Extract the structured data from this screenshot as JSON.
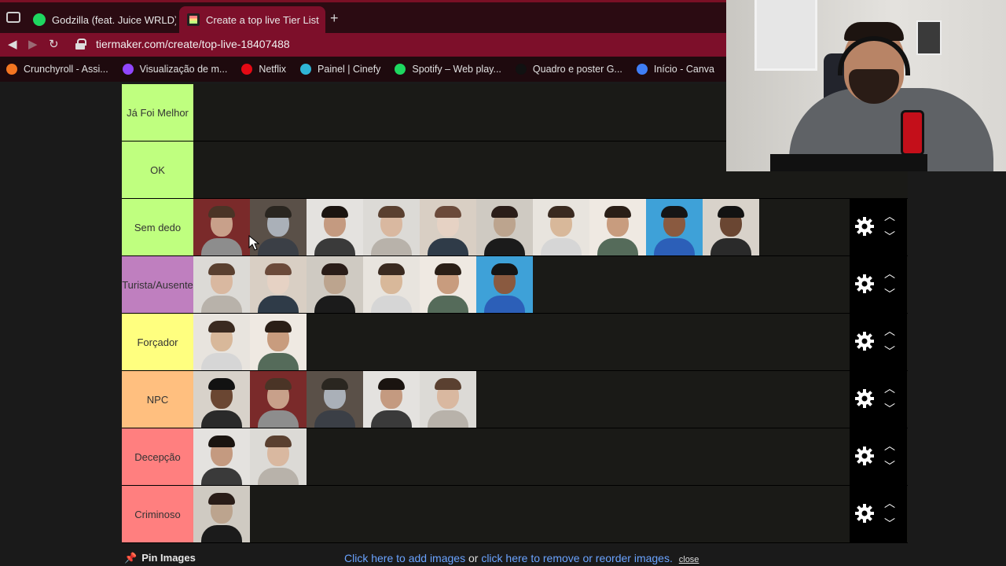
{
  "browser": {
    "tabs": [
      {
        "label": "Godzilla (feat. Juice WRLD)",
        "icon": "spotify-icon",
        "active": false
      },
      {
        "label": "Create a top live Tier List",
        "icon": "tiermaker-icon",
        "active": true
      }
    ],
    "new_tab": "+",
    "url": "tiermaker.com/create/top-live-18407488",
    "bookmarks": [
      {
        "label": "Crunchyroll - Assi...",
        "color": "#f47521"
      },
      {
        "label": "Visualização de m...",
        "color": "#9146ff"
      },
      {
        "label": "Netflix",
        "color": "#e50914"
      },
      {
        "label": "Painel | Cinefy",
        "color": "#2fb5d6"
      },
      {
        "label": "Spotify – Web play...",
        "color": "#1ed760"
      },
      {
        "label": "Quadro e poster G...",
        "color": "#111111"
      },
      {
        "label": "Início - Canva",
        "color": "#3f7ef6"
      }
    ]
  },
  "tiers": [
    {
      "label": "Já Foi Melhor",
      "color": "#bfff7f",
      "count": 0
    },
    {
      "label": "OK",
      "color": "#bfff7f",
      "count": 0
    },
    {
      "label": "Sem dedo",
      "color": "#bfff7f",
      "count": 10
    },
    {
      "label": "Turista/Ausente",
      "color": "#bf7fbf",
      "count": 6
    },
    {
      "label": "Forçador",
      "color": "#ffff7f",
      "count": 2
    },
    {
      "label": "NPC",
      "color": "#ffbf7f",
      "count": 5
    },
    {
      "label": "Decepção",
      "color": "#ff7f7f",
      "count": 2
    },
    {
      "label": "Criminoso",
      "color": "#ff7f7f",
      "count": 1
    }
  ],
  "footer": {
    "pin_label": "Pin Images",
    "add_link": "Click here to add images",
    "or_text": " or ",
    "remove_link": "click here to remove or reorder images.",
    "close_label": "close"
  }
}
